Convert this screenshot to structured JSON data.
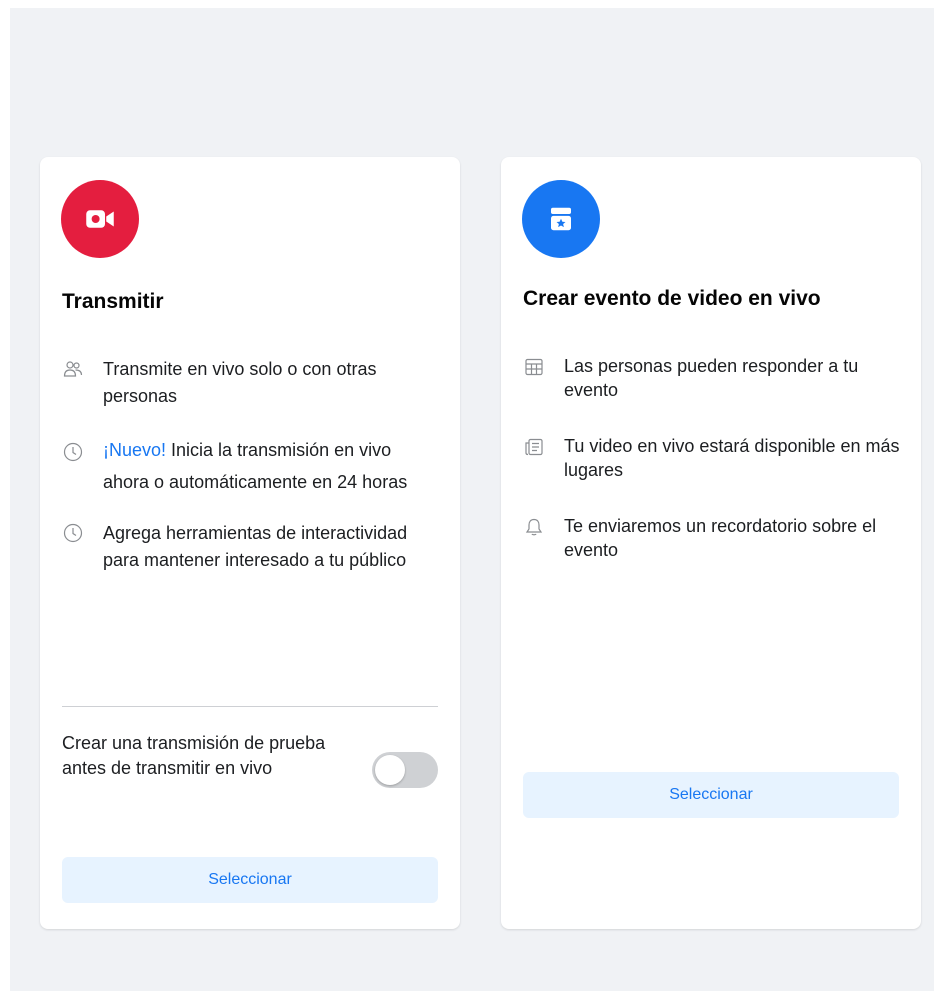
{
  "colors": {
    "broadcast_badge": "#e41e3f",
    "event_badge": "#1877f2",
    "accent": "#1877f2",
    "button_bg": "#e7f3ff",
    "page_bg": "#f0f2f5"
  },
  "cards": [
    {
      "icon": "video-camera-icon",
      "title": "Transmitir",
      "features": [
        {
          "icon": "people-icon",
          "text": "Transmite en vivo solo o con otras personas"
        },
        {
          "icon": "clock-icon",
          "tag": "¡Nuevo!",
          "text": " Inicia la transmisión en vivo ahora o automáticamente en 24 horas"
        },
        {
          "icon": "clock-icon",
          "text": "Agrega herramientas de interactividad para mantener interesado a tu público"
        }
      ],
      "toggle": {
        "label": "Crear una transmisión de prueba antes de transmitir en vivo",
        "on": false
      },
      "button": "Seleccionar"
    },
    {
      "icon": "calendar-star-icon",
      "title": "Crear evento de video en vivo",
      "features": [
        {
          "icon": "calendar-grid-icon",
          "text": "Las personas pueden responder a tu evento"
        },
        {
          "icon": "news-feed-icon",
          "text": "Tu video en vivo estará disponible en más lugares"
        },
        {
          "icon": "bell-icon",
          "text": "Te enviaremos un recordatorio sobre el evento"
        }
      ],
      "button": "Seleccionar"
    }
  ]
}
